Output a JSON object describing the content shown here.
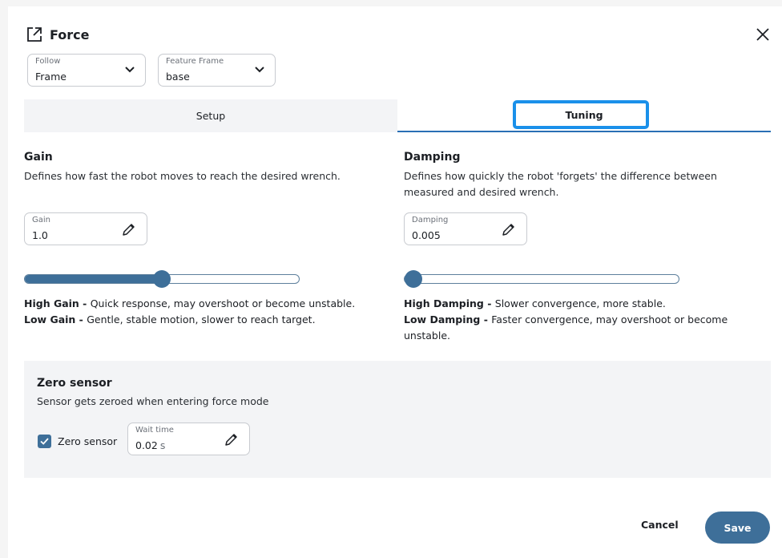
{
  "header": {
    "title": "Force",
    "icon": "external-link-icon",
    "close_icon": "close-icon"
  },
  "selects": {
    "follow": {
      "label": "Follow",
      "value": "Frame"
    },
    "feature_frame": {
      "label": "Feature Frame",
      "value": "base"
    }
  },
  "tabs": [
    {
      "label": "Setup",
      "active": false
    },
    {
      "label": "Tuning",
      "active": true
    }
  ],
  "gain": {
    "title": "Gain",
    "description": "Defines how fast the robot moves to reach the desired wrench.",
    "field_label": "Gain",
    "field_value": "1.0",
    "slider_fraction": 0.5,
    "high_label": "High Gain - ",
    "high_text": "Quick response, may overshoot or become unstable.",
    "low_label": "Low Gain - ",
    "low_text": "Gentle, stable motion, slower to reach target."
  },
  "damping": {
    "title": "Damping",
    "description": "Defines how quickly the robot 'forgets' the difference between measured and desired wrench.",
    "field_label": "Damping",
    "field_value": "0.005",
    "slider_fraction": 0.0,
    "high_label": "High Damping - ",
    "high_text": "Slower convergence, more stable.",
    "low_label": "Low Damping - ",
    "low_text": "Faster convergence, may overshoot or become unstable."
  },
  "zero_sensor": {
    "title": "Zero sensor",
    "description": "Sensor gets zeroed when entering force mode",
    "checkbox_label": "Zero sensor",
    "checked": true,
    "wait_label": "Wait time",
    "wait_value": "0.02",
    "wait_unit": "s"
  },
  "footer": {
    "cancel_label": "Cancel",
    "save_label": "Save"
  },
  "colors": {
    "accent": "#3e6f99",
    "focus": "#1a90ea",
    "tab_underline": "#2a6fb5"
  }
}
